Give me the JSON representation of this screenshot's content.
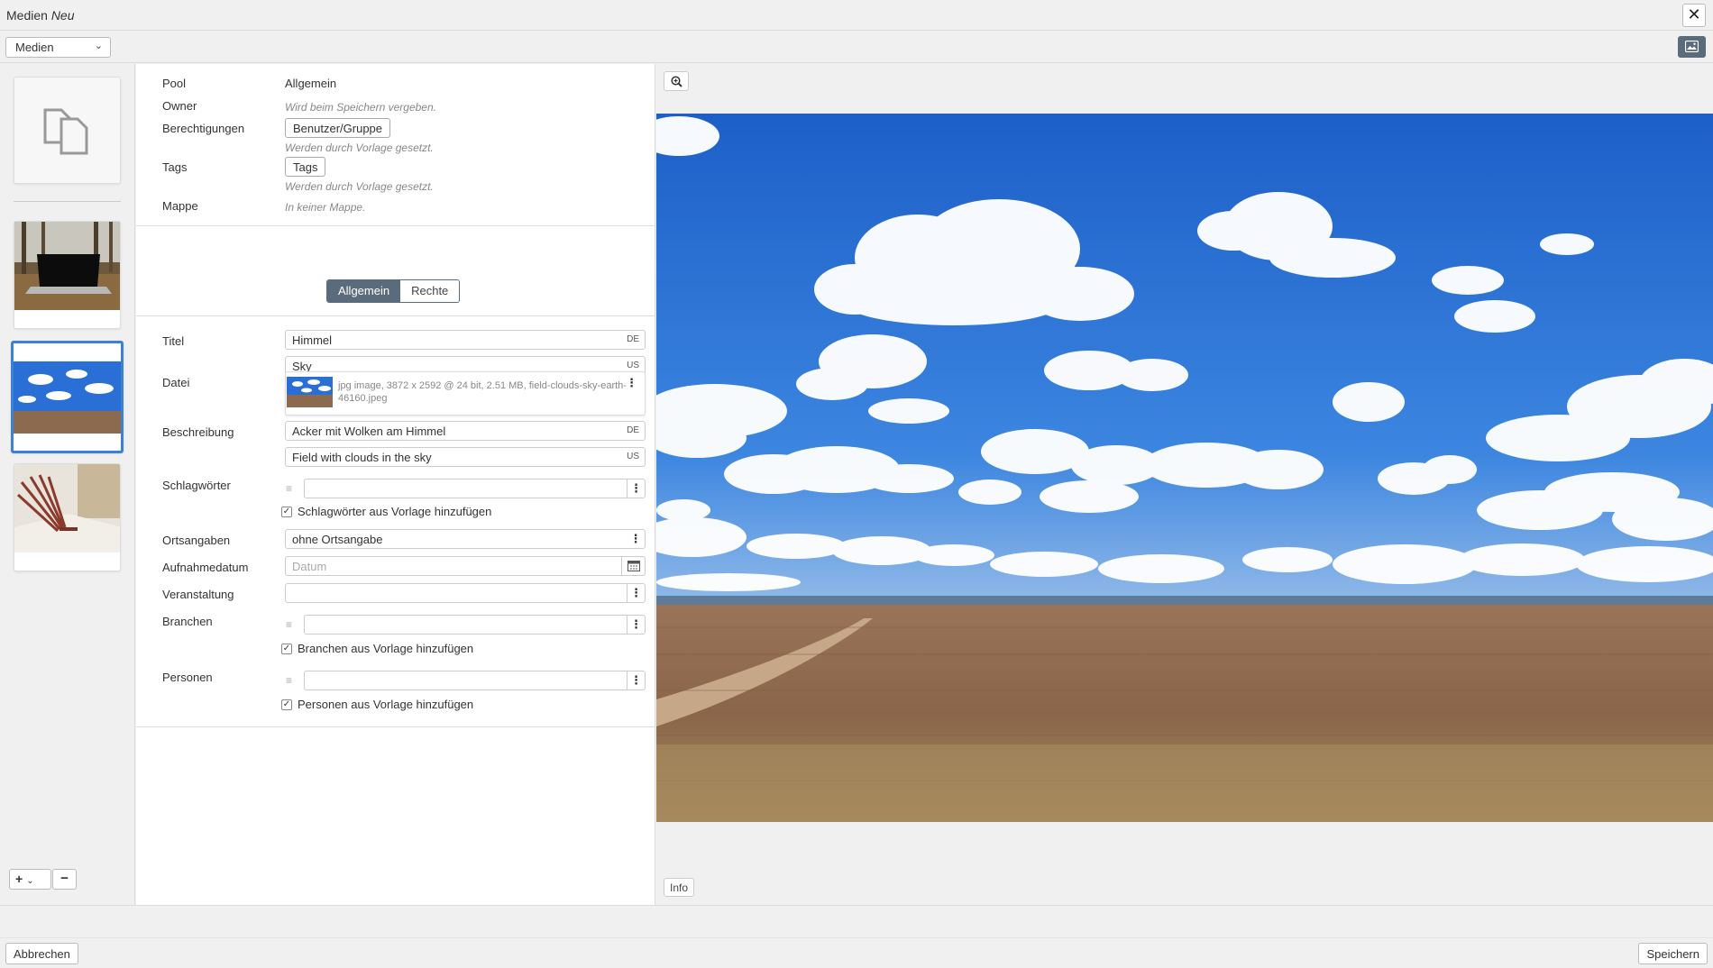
{
  "window": {
    "title": "Medien",
    "title_suffix": "Neu",
    "close_glyph": "✕"
  },
  "toolbar": {
    "type_select": "Medien",
    "chevron": "⌄"
  },
  "sidebar": {
    "add_glyph": "+",
    "add_chevron": "⌄",
    "remove_glyph": "−",
    "thumbnails": [
      "new-media-placeholder",
      "laptop-forest",
      "field-clouds-sky",
      "open-book"
    ]
  },
  "meta": {
    "pool_label": "Pool",
    "pool_value": "Allgemein",
    "owner_label": "Owner",
    "owner_hint": "Wird beim Speichern vergeben.",
    "permissions_label": "Berechtigungen",
    "permissions_button": "Benutzer/Gruppe",
    "permissions_hint": "Werden durch Vorlage gesetzt.",
    "tags_label": "Tags",
    "tags_button": "Tags",
    "tags_hint": "Werden durch Vorlage gesetzt.",
    "folder_label": "Mappe",
    "folder_hint": "In keiner Mappe."
  },
  "tabs": {
    "general": "Allgemein",
    "rights": "Rechte",
    "active": "Allgemein"
  },
  "form": {
    "title_label": "Titel",
    "title_de": "Himmel",
    "title_de_flag": "DE",
    "title_us": "Sky",
    "title_us_flag": "US",
    "file_label": "Datei",
    "file_info": "jpg image, 3872 x 2592 @ 24 bit, 2.51 MB, field-clouds-sky-earth-46160.jpeg",
    "description_label": "Beschreibung",
    "description_de": "Acker mit Wolken am Himmel",
    "description_de_flag": "DE",
    "description_us": "Field with clouds in the sky",
    "description_us_flag": "US",
    "keywords_label": "Schlagwörter",
    "keywords_check": "Schlagwörter aus Vorlage hinzufügen",
    "location_label": "Ortsangaben",
    "location_value": "ohne Ortsangabe",
    "date_label": "Aufnahmedatum",
    "date_placeholder": "Datum",
    "event_label": "Veranstaltung",
    "industries_label": "Branchen",
    "industries_check": "Branchen aus Vorlage hinzufügen",
    "persons_label": "Personen",
    "persons_check": "Personen aus Vorlage hinzufügen",
    "dots_glyph": "⋮",
    "check_glyph": "✓",
    "grip_glyph": "≡"
  },
  "preview": {
    "info_button": "Info",
    "icons": [
      "zoom-in-icon",
      "image-icon"
    ]
  },
  "footer": {
    "cancel": "Abbrechen",
    "save": "Speichern"
  },
  "colors": {
    "accent_dark": "#5a6b7b",
    "selection_blue": "#3c82d4",
    "sky_blue": "#2a6fd6",
    "field_brown": "#8c6a4f"
  }
}
